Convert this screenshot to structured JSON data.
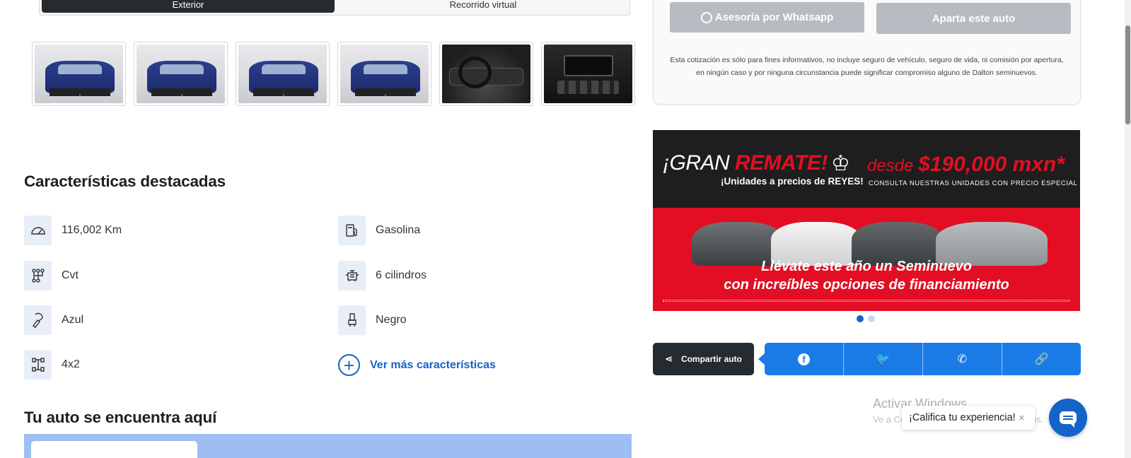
{
  "gallery": {
    "view_tabs": [
      {
        "label": "Exterior",
        "active": true
      },
      {
        "label": "Recorrido virtual",
        "active": false
      }
    ],
    "thumbnails": [
      {
        "alt": "exterior-front-left"
      },
      {
        "alt": "exterior-front-left-2"
      },
      {
        "alt": "exterior-front"
      },
      {
        "alt": "exterior-rear"
      },
      {
        "alt": "interior-dashboard"
      },
      {
        "alt": "interior-console"
      }
    ]
  },
  "features": {
    "title": "Características destacadas",
    "items": [
      {
        "icon": "speedometer-icon",
        "label": "116,002 Km"
      },
      {
        "icon": "fuel-pump-icon",
        "label": "Gasolina"
      },
      {
        "icon": "transmission-icon",
        "label": "Cvt"
      },
      {
        "icon": "engine-icon",
        "label": "6 cilindros"
      },
      {
        "icon": "paint-icon",
        "label": "Azul"
      },
      {
        "icon": "seat-icon",
        "label": "Negro"
      },
      {
        "icon": "drivetrain-icon",
        "label": "4x2"
      }
    ],
    "more_label": "Ver más características"
  },
  "location": {
    "title": "Tu auto se encuentra aquí"
  },
  "quote": {
    "whatsapp_label": "Asesoría por Whatsapp",
    "reserve_label": "Aparta este auto",
    "disclaimer": "Esta cotización es sólo para fines informativos, no incluye seguro de vehículo, seguro de vida, ni comisión por apertura, en ningún caso y por ninguna circunstancia puede significar compromiso alguno de Dalton seminuevos."
  },
  "banner": {
    "headline_prefix": "¡GRAN ",
    "headline_emph": "REMATE!",
    "price_prefix": "desde ",
    "price_value": "$190,000 mxn*",
    "sub1": "¡Unidades a precios de REYES!",
    "sub2": "CONSULTA NUESTRAS UNIDADES CON PRECIO ESPECIAL",
    "tag1": "Llévate este año un Seminuevo",
    "tag2": "con increíbles opciones de financiamiento",
    "slide_count": 2,
    "active_slide": 1
  },
  "share": {
    "label": "Compartir auto",
    "buttons": [
      {
        "icon": "facebook-icon",
        "glyph": "f"
      },
      {
        "icon": "twitter-icon",
        "glyph": "🐦"
      },
      {
        "icon": "whatsapp-icon",
        "glyph": "✆"
      },
      {
        "icon": "link-icon",
        "glyph": "🔗"
      }
    ]
  },
  "overlay": {
    "windows_watermark": "Activar Windows",
    "windows_watermark_sub": "Ve a Configuración para activar Windows.",
    "rate_prompt": "¡Califica tu experiencia!"
  },
  "colors": {
    "accent_blue": "#1464c8",
    "share_blue": "#1b7be6",
    "banner_red": "#e30e23",
    "dark": "#262b2f",
    "button_disabled": "#b7bcc2"
  }
}
